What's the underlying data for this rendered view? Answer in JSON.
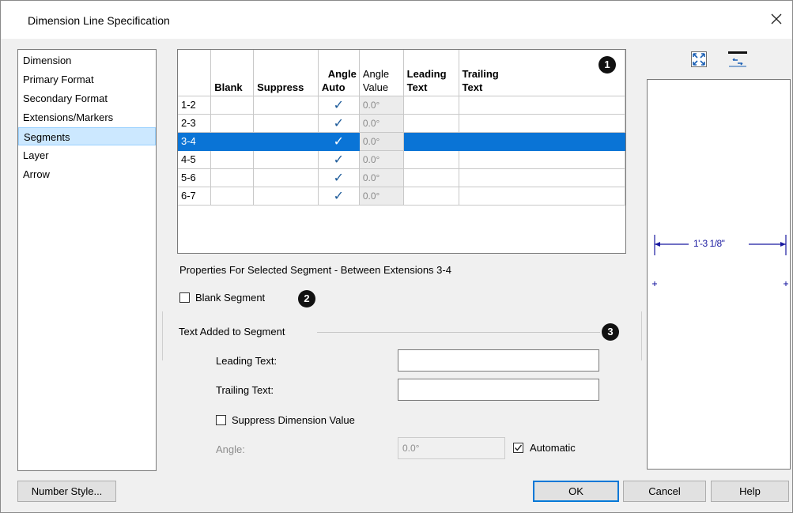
{
  "window": {
    "title": "Dimension Line Specification"
  },
  "nav": {
    "items": [
      {
        "label": "Dimension"
      },
      {
        "label": "Primary Format"
      },
      {
        "label": "Secondary Format"
      },
      {
        "label": "Extensions/Markers"
      },
      {
        "label": "Segments"
      },
      {
        "label": "Layer"
      },
      {
        "label": "Arrow"
      }
    ],
    "selected": "Segments"
  },
  "segments_table": {
    "headers": {
      "blank": "Blank",
      "suppress": "Suppress",
      "angle_auto_1": "Angle",
      "angle_auto_2": "Auto",
      "angle_value_1": "Angle",
      "angle_value_2": "Value",
      "leading_1": "Leading",
      "leading_2": "Text",
      "trailing_1": "Trailing",
      "trailing_2": "Text"
    },
    "rows": [
      {
        "segment": "1-2",
        "check": "✓",
        "angle": "0.0°"
      },
      {
        "segment": "2-3",
        "check": "✓",
        "angle": "0.0°"
      },
      {
        "segment": "3-4",
        "check": "✓",
        "angle": "0.0°"
      },
      {
        "segment": "4-5",
        "check": "✓",
        "angle": "0.0°"
      },
      {
        "segment": "5-6",
        "check": "✓",
        "angle": "0.0°"
      },
      {
        "segment": "6-7",
        "check": "✓",
        "angle": "0.0°"
      }
    ],
    "selected_row": "3-4"
  },
  "callouts": {
    "c1": "1",
    "c2": "2",
    "c3": "3"
  },
  "properties": {
    "heading": "Properties For Selected Segment - Between Extensions 3-4",
    "blank_segment_label": "Blank Segment",
    "group_label": "Text Added to Segment",
    "leading_text_label": "Leading Text:",
    "leading_text_value": "",
    "trailing_text_label": "Trailing Text:",
    "trailing_text_value": "",
    "suppress_label": "Suppress Dimension Value",
    "angle_label": "Angle:",
    "angle_value": "0.0°",
    "automatic_label": "Automatic",
    "automatic_checked": true
  },
  "preview": {
    "dimension_text": "1'-3 1/8\""
  },
  "buttons": {
    "number_style": "Number Style...",
    "ok": "OK",
    "cancel": "Cancel",
    "help": "Help"
  },
  "colors": {
    "selection": "#0a74d6",
    "nav_selection": "#cce8ff",
    "dim_line": "#1a1aa0",
    "check": "#1c5a99"
  }
}
